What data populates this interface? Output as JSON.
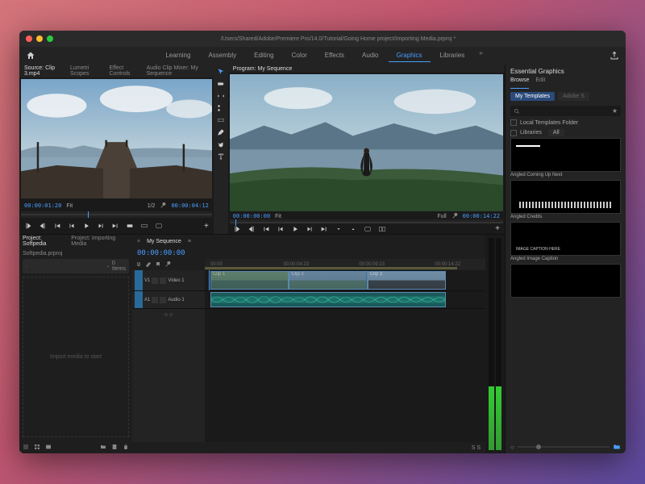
{
  "titlebar": {
    "title": "/Users/Shared/Adobe/Premiere Pro/14.0/Tutorial/Going Home project/Importing Media.prproj *"
  },
  "workspaces": [
    "Learning",
    "Assembly",
    "Editing",
    "Color",
    "Effects",
    "Audio",
    "Graphics",
    "Libraries"
  ],
  "workspace_active": "Graphics",
  "source": {
    "tabs": [
      "Source: Clip 3.mp4",
      "Lumetri Scopes",
      "Effect Controls",
      "Audio Clip Mixer: My Sequence"
    ],
    "tc_in": "00:00:01:20",
    "fit": "Fit",
    "ratio": "1/2",
    "tc_out": "00:00:04:12"
  },
  "program": {
    "tab": "Program: My Sequence",
    "tc_in": "00:00:00:00",
    "fit": "Fit",
    "quality": "Full",
    "tc_out": "00:00:14:22"
  },
  "project": {
    "tabs": [
      "Project: Softpedia",
      "Project: Importing Media"
    ],
    "filename": "Softpedia.prproj",
    "items": "0 Items",
    "empty": "Import media to start"
  },
  "timeline": {
    "sequence": "My Sequence",
    "tc": "00:00:00:00",
    "ruler": [
      "00:00",
      "00:00:04:23",
      "00:00:09:23",
      "00:00:14:22"
    ],
    "tracks": {
      "v1": {
        "id": "V1",
        "label": "Video 1"
      },
      "a1": {
        "id": "A1",
        "label": "Audio 1"
      }
    },
    "clips": [
      "Clip 1",
      "Clip 2",
      "Clip 3"
    ],
    "zoom": "S  S"
  },
  "eg": {
    "title": "Essential Graphics",
    "tabs": [
      "Browse",
      "Edit"
    ],
    "filter_my": "My Templates",
    "filter_adobe": "Adobe S",
    "search_placeholder": "",
    "check_local": "Local Templates Folder",
    "check_lib": "Libraries",
    "lib_all": "All",
    "templates": [
      "Angled Coming Up Next",
      "Angled Credits",
      "Angled Image Caption"
    ]
  },
  "icons": {
    "home": "home",
    "share": "share",
    "selection": "selection",
    "track-select": "track-select",
    "ripple": "ripple",
    "razor": "razor",
    "slip": "slip",
    "pen": "pen",
    "hand": "hand",
    "type": "type"
  }
}
